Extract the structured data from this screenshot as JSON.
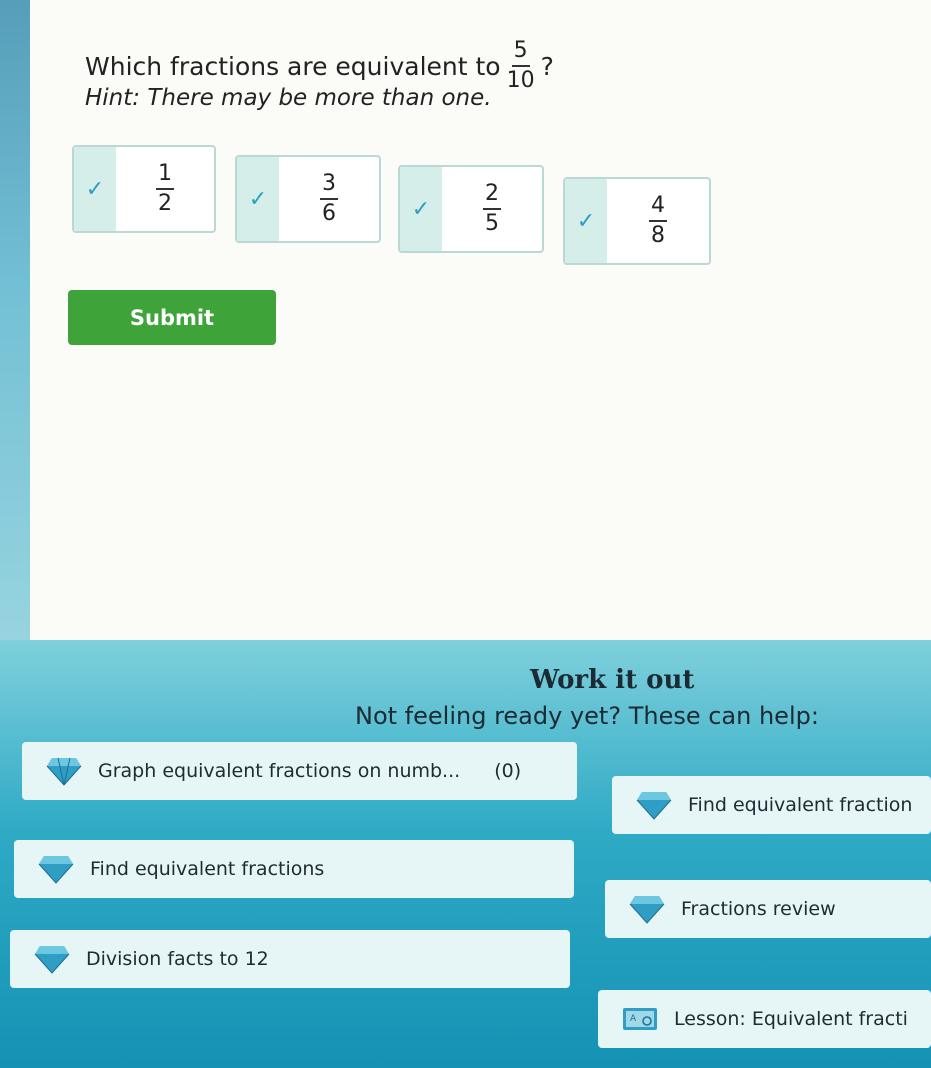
{
  "question": {
    "text": "Which fractions are equivalent to",
    "fraction_num": "5",
    "fraction_den": "10",
    "suffix": "?",
    "hint": "Hint: There may be more than one."
  },
  "choices": [
    {
      "num": "1",
      "den": "2",
      "checked": true
    },
    {
      "num": "3",
      "den": "6",
      "checked": true
    },
    {
      "num": "2",
      "den": "5",
      "checked": true
    },
    {
      "num": "4",
      "den": "8",
      "checked": true
    }
  ],
  "submit_label": "Submit",
  "help": {
    "title": "Work it out",
    "subtitle": "Not feeling ready yet? These can help:",
    "cards": [
      {
        "label": "Graph equivalent fractions on numb...",
        "count": "(0)",
        "icon": "diamond-icon"
      },
      {
        "label": "Find equivalent fraction",
        "icon": "diamond-icon"
      },
      {
        "label": "Find equivalent fractions",
        "icon": "diamond-icon"
      },
      {
        "label": "Fractions review",
        "icon": "diamond-icon"
      },
      {
        "label": "Division facts to 12",
        "icon": "diamond-icon"
      },
      {
        "label": "Lesson: Equivalent fracti",
        "icon": "lesson-icon"
      }
    ]
  },
  "colors": {
    "accent": "#3ea339",
    "check": "#2f9dc4",
    "help_bg": "#2eaac5"
  }
}
